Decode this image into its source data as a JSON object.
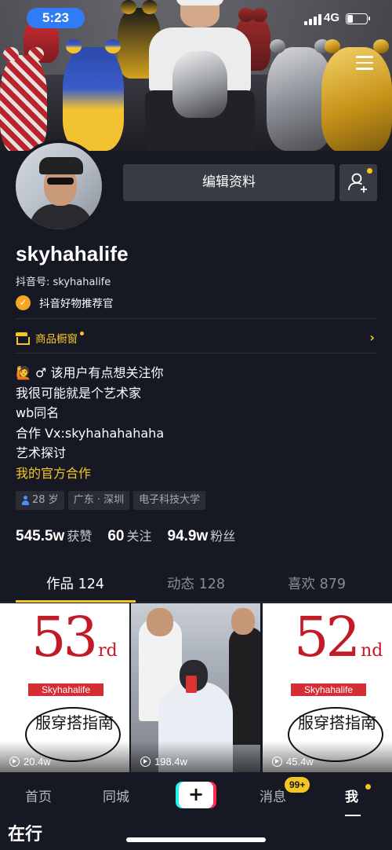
{
  "status_bar": {
    "time": "5:23",
    "network": "4G",
    "battery_level": 0.3
  },
  "profile": {
    "username": "skyhahalife",
    "douyin_id": "抖音号: skyhahalife",
    "verified_label": "抖音好物推荐官",
    "edit_button": "编辑资料",
    "shop_label": "商品橱窗",
    "bio": [
      "🙋 ♂  该用户有点想关注你",
      "我很可能就是个艺术家",
      "wb同名",
      "合作 Vx:skyhahahahaha",
      "艺术探讨"
    ],
    "official_link": "我的官方合作",
    "tags": {
      "age": "28 岁",
      "location": "广东 · 深圳",
      "school": "电子科技大学"
    },
    "stats": [
      {
        "value": "545.5w",
        "label": "获赞"
      },
      {
        "value": "60",
        "label": "关注"
      },
      {
        "value": "94.9w",
        "label": "粉丝"
      }
    ]
  },
  "tabs": [
    {
      "label": "作品 124",
      "active": true
    },
    {
      "label": "动态 128",
      "active": false
    },
    {
      "label": "喜欢 879",
      "active": false
    }
  ],
  "videos": [
    {
      "rank_num": "53",
      "rank_suffix": "rd",
      "brand": "Skyhahalife",
      "handwritten": "服穿搭指南",
      "views": "20.4w"
    },
    {
      "views": "198.4w"
    },
    {
      "rank_num": "52",
      "rank_suffix": "nd",
      "brand": "Skyhahalife",
      "handwritten": "服穿搭指南",
      "views": "45.4w"
    }
  ],
  "bottom_nav": {
    "home": "首页",
    "nearby": "同城",
    "create": "+",
    "messages": "消息",
    "messages_badge": "99+",
    "me": "我"
  },
  "watermark": "在行",
  "colors": {
    "background": "#161823",
    "accent": "#f5c623",
    "button_bg": "#393b44"
  }
}
